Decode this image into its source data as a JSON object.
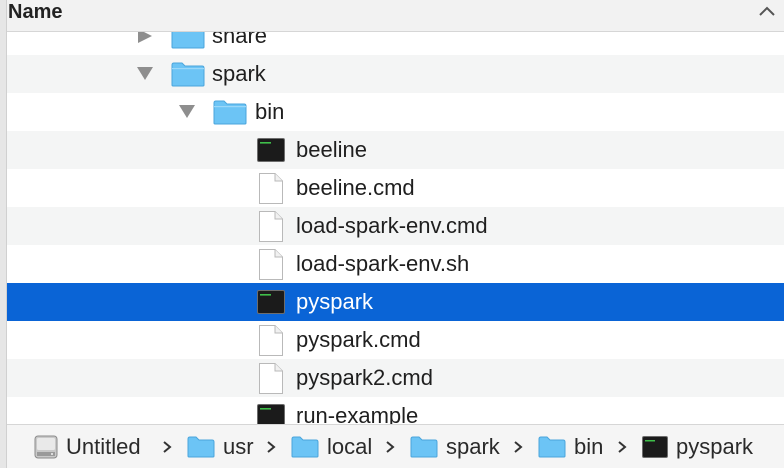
{
  "header": {
    "column_label": "Name",
    "sort_icon": "chevron-up-icon"
  },
  "rows": [
    {
      "label": "share",
      "kind": "folder",
      "expanded": false
    },
    {
      "label": "spark",
      "kind": "folder",
      "expanded": true
    },
    {
      "label": "bin",
      "kind": "folder",
      "expanded": true
    },
    {
      "label": "beeline",
      "kind": "executable"
    },
    {
      "label": "beeline.cmd",
      "kind": "document"
    },
    {
      "label": "load-spark-env.cmd",
      "kind": "document"
    },
    {
      "label": "load-spark-env.sh",
      "kind": "document"
    },
    {
      "label": "pyspark",
      "kind": "executable",
      "selected": true
    },
    {
      "label": "pyspark.cmd",
      "kind": "document"
    },
    {
      "label": "pyspark2.cmd",
      "kind": "document"
    },
    {
      "label": "run-example",
      "kind": "executable"
    }
  ],
  "pathbar": {
    "crumbs": [
      {
        "label": "Untitled",
        "icon": "hard-drive-icon"
      },
      {
        "label": "usr",
        "icon": "folder-icon"
      },
      {
        "label": "local",
        "icon": "folder-icon"
      },
      {
        "label": "spark",
        "icon": "folder-icon"
      },
      {
        "label": "bin",
        "icon": "folder-icon"
      },
      {
        "label": "pyspark",
        "icon": "terminal-icon"
      }
    ]
  },
  "colors": {
    "selection": "#0a64d6",
    "folder": "#6cc4f5",
    "alt_row": "#f4f5f5"
  }
}
